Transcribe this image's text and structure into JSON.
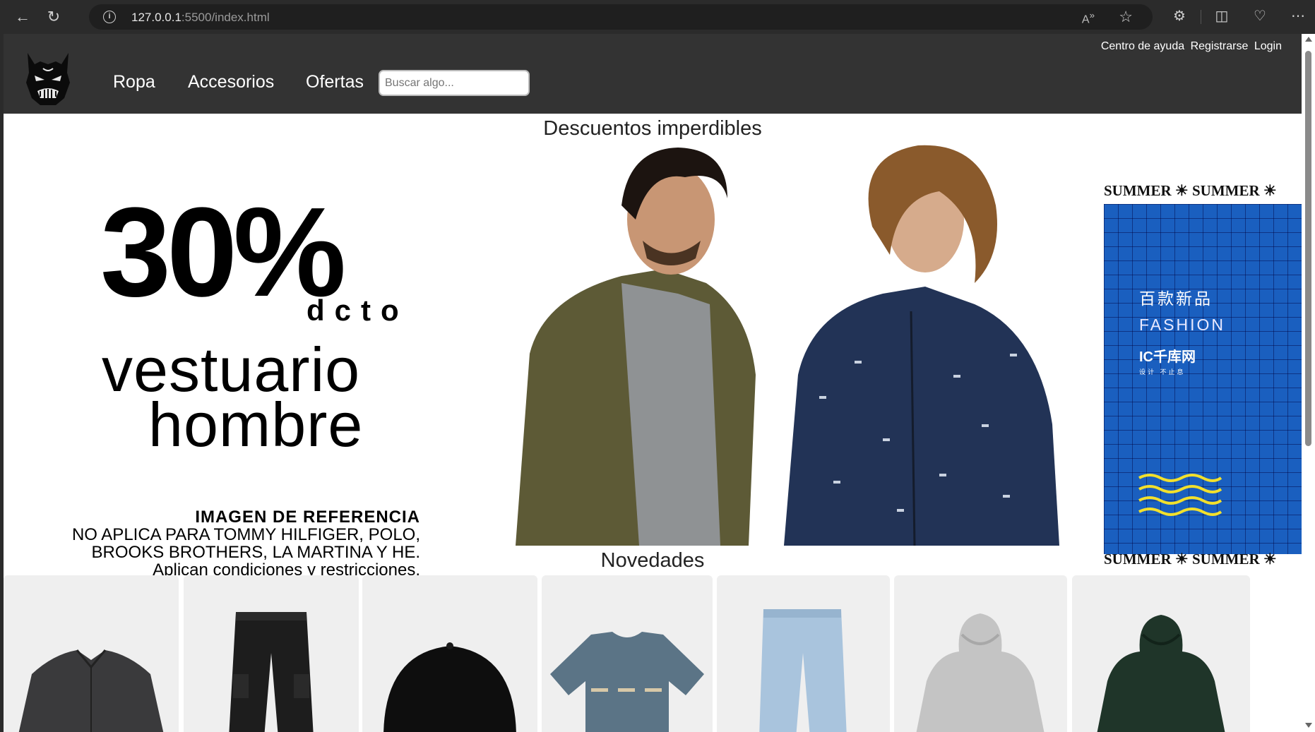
{
  "browser": {
    "url_host": "127.0.0.1",
    "url_path": ":5500/index.html"
  },
  "header": {
    "menu": [
      "Ropa",
      "Accesorios",
      "Ofertas"
    ],
    "search_placeholder": "Buscar algo...",
    "top_links": [
      "Centro de ayuda",
      "Registrarse",
      "Login"
    ]
  },
  "sections": {
    "deals_title": "Descuentos imperdibles",
    "new_title": "Novedades"
  },
  "banner": {
    "percent": "30%",
    "dcto": "dcto",
    "line1": "vestuario",
    "line2": "hombre",
    "ref_title": "IMAGEN DE REFERENCIA",
    "disclaimer1": "NO APLICA PARA TOMMY HILFIGER, POLO,",
    "disclaimer2": "BROOKS BROTHERS, LA MARTINA Y HE.",
    "disclaimer3": "Aplican condiciones y restricciones."
  },
  "summer_panel": {
    "strip_text": "SUMMER ☀ SUMMER ☀",
    "cn_text": "百款新品",
    "fashion": "FASHION",
    "brand": "IC千库网",
    "brand_sub": "设计 不止息"
  },
  "products": [
    {
      "name": "denim-jacket",
      "color": "#3a3a3c"
    },
    {
      "name": "cargo-pants",
      "color": "#1d1d1d"
    },
    {
      "name": "black-cap",
      "color": "#0e0e0e"
    },
    {
      "name": "blue-tshirt",
      "color": "#5b7486"
    },
    {
      "name": "light-jeans",
      "color": "#a9c4dd"
    },
    {
      "name": "grey-hoodie",
      "color": "#c4c4c4"
    },
    {
      "name": "green-hoodie",
      "color": "#1f3529"
    }
  ],
  "colors": {
    "header_bg": "#333333",
    "chrome_bg": "#2b2b2b"
  }
}
